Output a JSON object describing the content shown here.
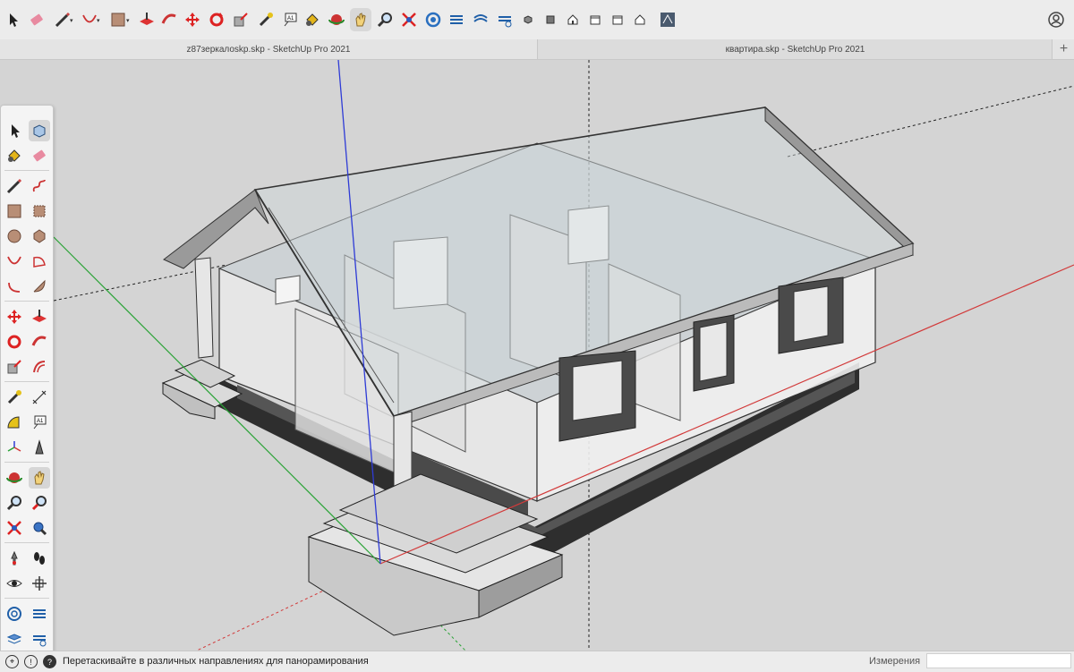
{
  "toolbar": {
    "tools": [
      "select-icon",
      "eraser-icon",
      "pencil-icon",
      "arc-icon",
      "rectangle-icon",
      "push-pull-icon",
      "follow-me-icon",
      "move-icon",
      "rotate-icon",
      "scale-icon",
      "tape-measure-icon",
      "text-icon",
      "paint-bucket-icon",
      "orbit-icon",
      "pan-icon",
      "zoom-icon",
      "zoom-extents-icon",
      "position-camera-icon",
      "section-plane-icon",
      "display-section-icon",
      "iso-view-icon",
      "top-view-icon",
      "front-view-icon",
      "right-view-icon",
      "back-view-icon",
      "left-view-icon",
      "warehouse-icon",
      "user-icon"
    ]
  },
  "tabs": [
    {
      "label": "z87зеркалоskp.skp - SketchUp Pro 2021"
    },
    {
      "label": "квартира.skp - SketchUp Pro 2021"
    }
  ],
  "tab_add_label": "+",
  "palette": {
    "tools": [
      "select",
      "component",
      "paint-bucket",
      "eraser",
      "line",
      "freehand",
      "rectangle",
      "rotated-rectangle",
      "circle",
      "polygon",
      "arc",
      "pie",
      "arc-3pt",
      "arc-2pt",
      "move",
      "push-pull",
      "rotate",
      "follow-me",
      "scale",
      "offset",
      "tape-measure",
      "dimension",
      "protractor",
      "text",
      "axes",
      "3d-text",
      "orbit",
      "pan",
      "zoom",
      "zoom-window",
      "zoom-extents",
      "previous-view",
      "position-camera",
      "walk",
      "look-around",
      "section-plane",
      "sandbox-from-contours",
      "sandbox-from-scratch",
      "sandbox-smoove",
      "sandbox-stamp"
    ]
  },
  "status": {
    "message": "Перетаскивайте в различных направлениях для панорамирования",
    "measure_label": "Измерения",
    "measure_value": ""
  },
  "colors": {
    "red_axis": "#d23a3a",
    "green_axis": "#2aa336",
    "blue_axis": "#2e3bd6",
    "background": "#d4d4d4"
  }
}
